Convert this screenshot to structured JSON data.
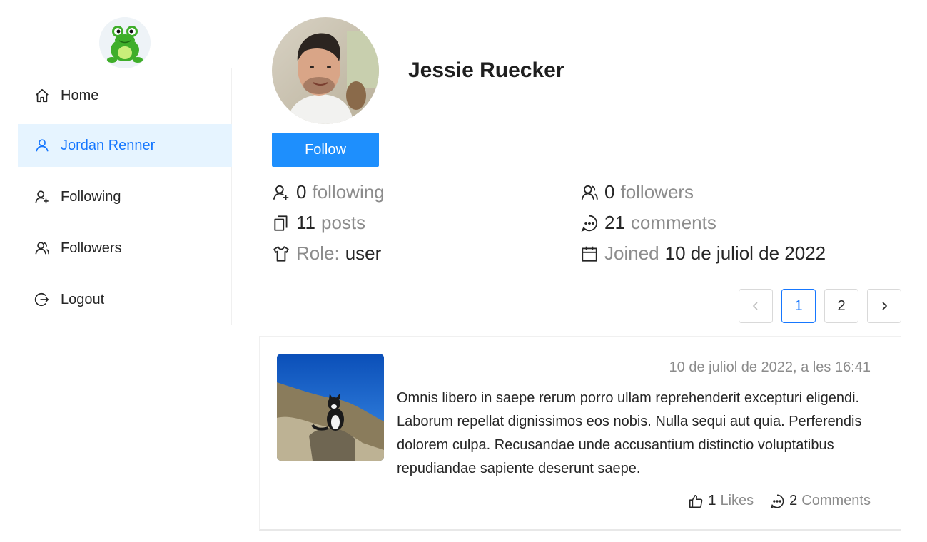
{
  "app": {
    "logo_icon": "frog-logo-icon"
  },
  "sidebar": {
    "items": [
      {
        "label": "Home",
        "icon": "home-icon"
      },
      {
        "label": "Jordan Renner",
        "icon": "user-icon",
        "active": true
      },
      {
        "label": "Following",
        "icon": "user-add-icon"
      },
      {
        "label": "Followers",
        "icon": "users-icon"
      },
      {
        "label": "Logout",
        "icon": "logout-icon"
      }
    ]
  },
  "profile": {
    "name": "Jessie Ruecker",
    "follow_label": "Follow",
    "stats": {
      "following_count": "0",
      "following_label": "following",
      "followers_count": "0",
      "followers_label": "followers",
      "posts_count": "11",
      "posts_label": "posts",
      "comments_count": "21",
      "comments_label": "comments",
      "role_label": "Role:",
      "role_value": "user",
      "joined_label": "Joined",
      "joined_value": "10 de juliol de 2022"
    }
  },
  "pagination": {
    "pages": [
      "1",
      "2"
    ],
    "current": "1"
  },
  "posts": [
    {
      "date": "10 de juliol de 2022, a les 16:41",
      "text": "Omnis libero in saepe rerum porro ullam reprehenderit excepturi eligendi. Laborum repellat dignissimos eos nobis. Nulla sequi aut quia. Perferendis dolorem culpa. Recusandae unde accusantium distinctio voluptatibus repudiandae sapiente deserunt saepe.",
      "likes_count": "1",
      "likes_label": "Likes",
      "comments_count": "2",
      "comments_label": "Comments"
    }
  ],
  "colors": {
    "primary": "#1677ff",
    "button": "#1e8ffd",
    "active_bg": "#e6f4ff",
    "muted": "#8c8c8c"
  }
}
